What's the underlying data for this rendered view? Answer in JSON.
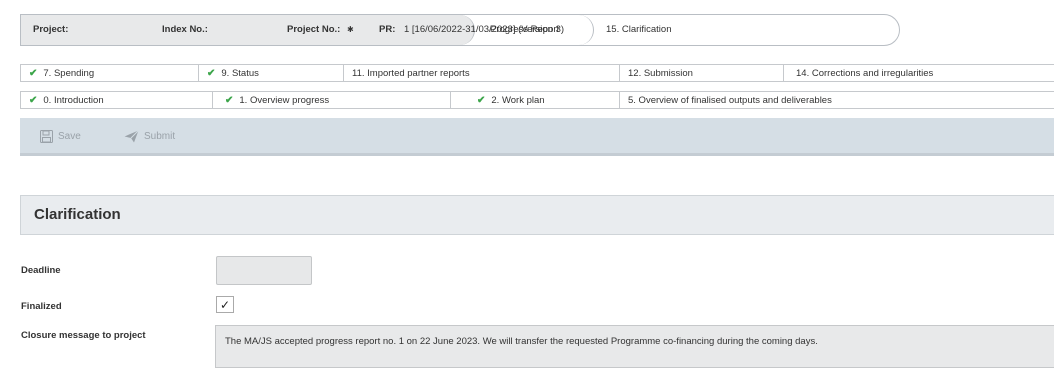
{
  "breadcrumb": {
    "project_label": "Project:",
    "index_label": "Index No.:",
    "project_no_label": "Project No.:",
    "project_no_value": "✱",
    "pr_label": "PR:",
    "pr_value": "1 [16/06/2022-31/03/2023] (Version 3)",
    "step_report": "Progress Report",
    "step_current": "15. Clarification"
  },
  "tabs_row1": [
    {
      "label": "7. Spending",
      "done": "✔"
    },
    {
      "label": "9. Status",
      "done": "✔"
    },
    {
      "label": "11. Imported partner reports",
      "done": ""
    },
    {
      "label": "12. Submission",
      "done": ""
    },
    {
      "label": "14. Corrections and irregularities",
      "done": ""
    }
  ],
  "tabs_row2": [
    {
      "label": "0. Introduction",
      "done": "✔"
    },
    {
      "label": "1. Overview progress",
      "done": "✔"
    },
    {
      "label": "2. Work plan",
      "done": "✔"
    },
    {
      "label": "5. Overview of finalised outputs and deliverables",
      "done": ""
    }
  ],
  "toolbar": {
    "save_label": "Save",
    "save_icon": "floppy-disk-icon",
    "submit_label": "Submit",
    "submit_icon": "paper-plane-icon"
  },
  "section": {
    "title": "Clarification"
  },
  "form": {
    "deadline_label": "Deadline",
    "deadline_value": "",
    "finalized_label": "Finalized",
    "finalized_mark": "✓",
    "closure_label": "Closure message to project",
    "closure_value": "The MA/JS accepted progress report no. 1 on 22 June 2023. We will transfer the requested Programme co-financing during the coming days."
  },
  "colors": {
    "check_green": "#3ca54a",
    "toolbar_bg": "#d5dee5",
    "header_bg": "#e9ecef"
  }
}
